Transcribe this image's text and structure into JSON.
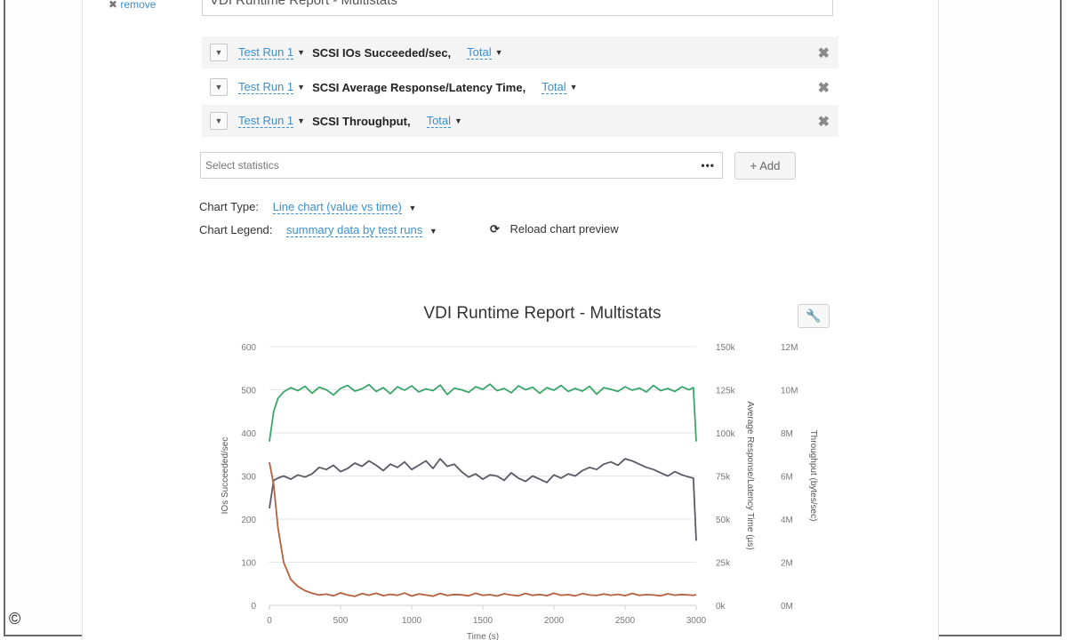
{
  "remove": {
    "icon": "✖",
    "label": "remove"
  },
  "report": {
    "title_value": "VDI Runtime Report - Multistats"
  },
  "statistics": [
    {
      "run": "Test Run 1",
      "name": "SCSI IOs Succeeded/sec,",
      "aggregate": "Total"
    },
    {
      "run": "Test Run 1",
      "name": "SCSI Average Response/Latency Time,",
      "aggregate": "Total"
    },
    {
      "run": "Test Run 1",
      "name": "SCSI Throughput,",
      "aggregate": "Total"
    }
  ],
  "select": {
    "placeholder": "Select statistics",
    "more": "•••",
    "add_label": "Add"
  },
  "chart_options": {
    "type_label": "Chart Type:",
    "type_value": "Line chart (value vs time)",
    "legend_label": "Chart Legend:",
    "legend_value": "summary data by test runs",
    "reload_label": "Reload chart preview"
  },
  "copyright": "©",
  "chart_data": {
    "type": "line",
    "title": "VDI Runtime Report - Multistats",
    "xlabel": "Time (s)",
    "xlim": [
      0,
      3000
    ],
    "x_ticks": [
      "0",
      "500",
      "1000",
      "1500",
      "2000",
      "2500",
      "3000"
    ],
    "y_axes": [
      {
        "label": "IOs Succeeded/sec",
        "range": [
          0,
          600
        ],
        "ticks": [
          "0",
          "100",
          "200",
          "300",
          "400",
          "500",
          "600"
        ],
        "side": "left"
      },
      {
        "label": "Average Response/Latency Time (µs)",
        "range": [
          0,
          150000
        ],
        "ticks": [
          "0k",
          "25k",
          "50k",
          "75k",
          "100k",
          "125k",
          "150k"
        ],
        "side": "right"
      },
      {
        "label": "Throughput (bytes/sec)",
        "range": [
          0,
          12000000
        ],
        "ticks": [
          "0M",
          "2M",
          "4M",
          "6M",
          "8M",
          "10M",
          "12M"
        ],
        "side": "right"
      }
    ],
    "grid": true,
    "series": [
      {
        "color": "#3aa66a",
        "axis": 0,
        "x": [
          0,
          30,
          60,
          100,
          150,
          200,
          250,
          300,
          350,
          400,
          450,
          500,
          550,
          600,
          650,
          700,
          750,
          800,
          850,
          900,
          950,
          1000,
          1050,
          1100,
          1150,
          1200,
          1250,
          1300,
          1350,
          1400,
          1450,
          1500,
          1550,
          1600,
          1650,
          1700,
          1750,
          1800,
          1850,
          1900,
          1950,
          2000,
          2050,
          2100,
          2150,
          2200,
          2250,
          2300,
          2350,
          2400,
          2450,
          2500,
          2550,
          2600,
          2650,
          2700,
          2750,
          2800,
          2850,
          2900,
          2950,
          2980,
          3000
        ],
        "y": [
          380,
          450,
          480,
          495,
          505,
          498,
          508,
          492,
          506,
          500,
          488,
          503,
          510,
          497,
          502,
          512,
          496,
          505,
          491,
          507,
          499,
          509,
          495,
          502,
          498,
          511,
          489,
          504,
          500,
          494,
          507,
          501,
          513,
          498,
          503,
          493,
          509,
          500,
          506,
          492,
          505,
          499,
          510,
          496,
          503,
          497,
          508,
          490,
          505,
          501,
          496,
          507,
          499,
          504,
          495,
          510,
          498,
          503,
          496,
          507,
          500,
          505,
          380
        ]
      },
      {
        "color": "#5d5866",
        "axis": 2,
        "x": [
          0,
          30,
          60,
          100,
          150,
          200,
          250,
          300,
          350,
          400,
          450,
          500,
          550,
          600,
          650,
          700,
          750,
          800,
          850,
          900,
          950,
          1000,
          1050,
          1100,
          1150,
          1200,
          1250,
          1300,
          1350,
          1400,
          1450,
          1500,
          1550,
          1600,
          1650,
          1700,
          1750,
          1800,
          1850,
          1900,
          1950,
          2000,
          2050,
          2100,
          2150,
          2200,
          2250,
          2300,
          2350,
          2400,
          2450,
          2500,
          2550,
          2600,
          2650,
          2700,
          2750,
          2800,
          2850,
          2900,
          2950,
          2980,
          3000
        ],
        "y": [
          4500000,
          5800000,
          5900000,
          6000000,
          5850000,
          6050000,
          5950000,
          6100000,
          6400000,
          6300000,
          6500000,
          6200000,
          6350000,
          6600000,
          6450000,
          6700000,
          6500000,
          6250000,
          6550000,
          6400000,
          6650000,
          6300000,
          6500000,
          6700000,
          6350000,
          6800000,
          6450000,
          6550000,
          6200000,
          5950000,
          6100000,
          5850000,
          6050000,
          6000000,
          5800000,
          6150000,
          5900000,
          5750000,
          6000000,
          5850000,
          5700000,
          6050000,
          5900000,
          6100000,
          6000000,
          6250000,
          6400000,
          6300000,
          6550000,
          6650000,
          6500000,
          6800000,
          6700000,
          6550000,
          6400000,
          6300000,
          6150000,
          6000000,
          6200000,
          6050000,
          5950000,
          5900000,
          3000000
        ]
      },
      {
        "color": "#b5603f",
        "axis": 1,
        "x": [
          0,
          30,
          60,
          100,
          150,
          200,
          250,
          300,
          350,
          400,
          450,
          500,
          550,
          600,
          650,
          700,
          750,
          800,
          850,
          900,
          950,
          1000,
          1050,
          1100,
          1150,
          1200,
          1250,
          1300,
          1350,
          1400,
          1450,
          1500,
          1550,
          1600,
          1650,
          1700,
          1750,
          1800,
          1850,
          1900,
          1950,
          2000,
          2050,
          2100,
          2150,
          2200,
          2250,
          2300,
          2350,
          2400,
          2450,
          2500,
          2550,
          2600,
          2650,
          2700,
          2750,
          2800,
          2850,
          2900,
          2950,
          2980,
          3000
        ],
        "y": [
          83000,
          70000,
          45000,
          25000,
          15000,
          11000,
          8500,
          7000,
          6000,
          6500,
          5500,
          7200,
          6000,
          5200,
          6800,
          5900,
          7000,
          5600,
          6400,
          5800,
          7100,
          5400,
          6600,
          6000,
          5300,
          6900,
          5700,
          6300,
          6100,
          5500,
          7000,
          5800,
          6200,
          5400,
          6700,
          6000,
          5500,
          6900,
          5800,
          6300,
          5600,
          7000,
          5900,
          6200,
          5500,
          6800,
          6000,
          5700,
          6600,
          5900,
          6400,
          5600,
          6900,
          5800,
          6200,
          6000,
          5500,
          6700,
          5900,
          6300,
          6000,
          5800,
          6200
        ]
      }
    ]
  }
}
